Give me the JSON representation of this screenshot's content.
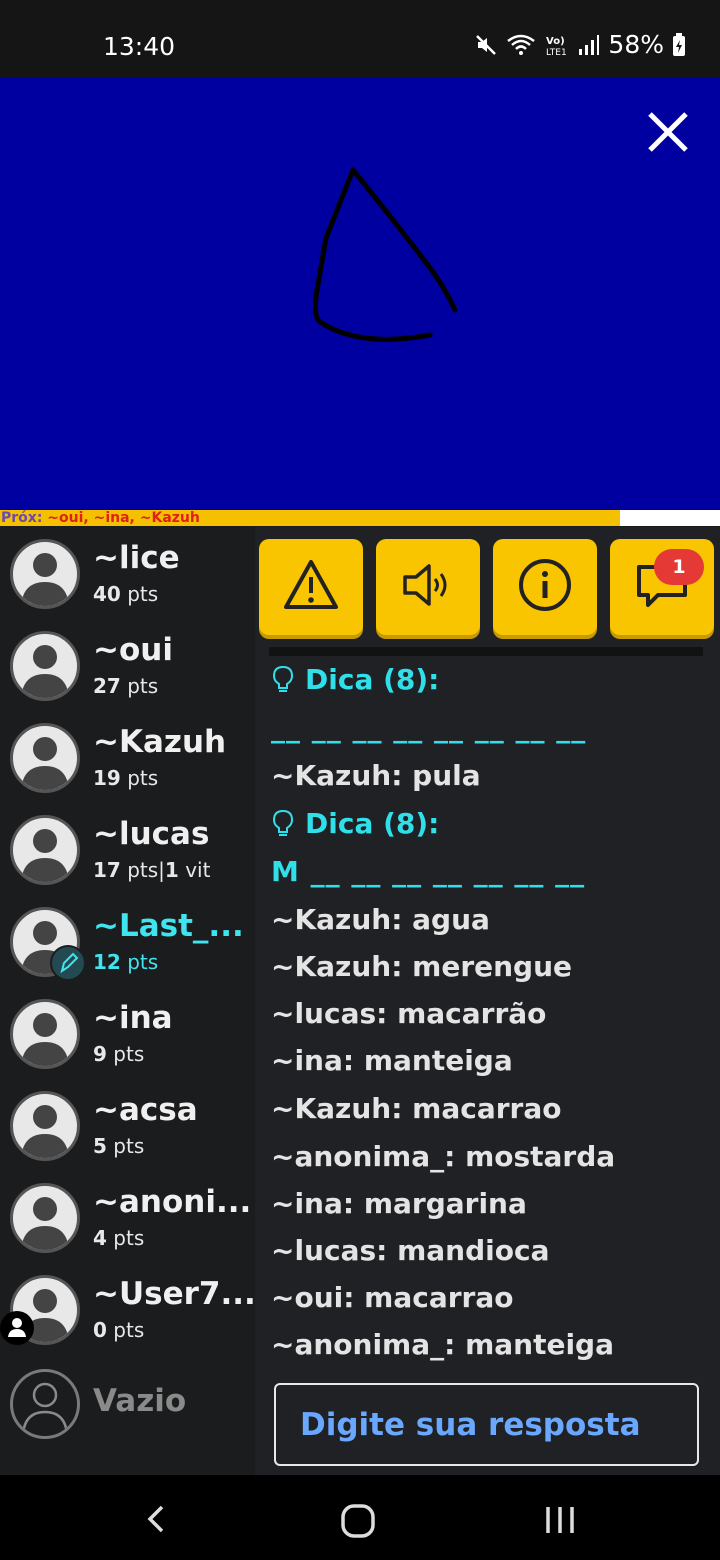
{
  "status": {
    "time": "13:40",
    "battery": "58%"
  },
  "canvas": {
    "background": "#0000a0"
  },
  "next": {
    "label": "Próx:",
    "names": "~oui, ~ina, ~Kazuh"
  },
  "players": [
    {
      "name": "~lice",
      "points": "40",
      "pts_label": "pts"
    },
    {
      "name": "~oui",
      "points": "27",
      "pts_label": "pts"
    },
    {
      "name": "~Kazuh",
      "points": "19",
      "pts_label": "pts"
    },
    {
      "name": "~lucas",
      "points": "17",
      "pts_label": "pts",
      "wins": "1",
      "wins_label": "vit"
    },
    {
      "name": "~Last_...",
      "points": "12",
      "pts_label": "pts",
      "drawing": true
    },
    {
      "name": "~ina",
      "points": "9",
      "pts_label": "pts"
    },
    {
      "name": "~acsa",
      "points": "5",
      "pts_label": "pts"
    },
    {
      "name": "~anoni...",
      "points": "4",
      "pts_label": "pts"
    },
    {
      "name": "~User7...",
      "points": "0",
      "pts_label": "pts"
    }
  ],
  "empty_slot": {
    "label": "Vazio"
  },
  "toolbar": {
    "report_icon": "warning-icon",
    "sound_icon": "speaker-icon",
    "info_icon": "info-icon",
    "chat_icon": "chat-bubble-icon",
    "chat_badge": "1"
  },
  "chat": [
    {
      "type": "hint",
      "text": "Dica (8):"
    },
    {
      "type": "blanks",
      "text": "__ __ __ __ __ __ __ __"
    },
    {
      "type": "msg",
      "text": "~Kazuh: pula"
    },
    {
      "type": "hint",
      "text": "Dica (8):"
    },
    {
      "type": "blanks",
      "text": "M __ __ __ __ __ __ __"
    },
    {
      "type": "msg",
      "text": "~Kazuh: agua"
    },
    {
      "type": "msg",
      "text": "~Kazuh: merengue"
    },
    {
      "type": "msg",
      "text": "~lucas: macarrão"
    },
    {
      "type": "msg",
      "text": "~ina: manteiga"
    },
    {
      "type": "msg",
      "text": "~Kazuh: macarrao"
    },
    {
      "type": "msg",
      "text": "~anonima_: mostarda"
    },
    {
      "type": "msg",
      "text": "~ina: margarina"
    },
    {
      "type": "msg",
      "text": "~lucas: mandioca"
    },
    {
      "type": "msg",
      "text": "~oui: macarrao"
    },
    {
      "type": "msg",
      "text": "~anonima_: manteiga"
    }
  ],
  "answer": {
    "placeholder": "Digite sua resposta"
  },
  "colors": {
    "accent": "#f9c400",
    "hint": "#2fe0ea",
    "badge": "#e53935"
  }
}
